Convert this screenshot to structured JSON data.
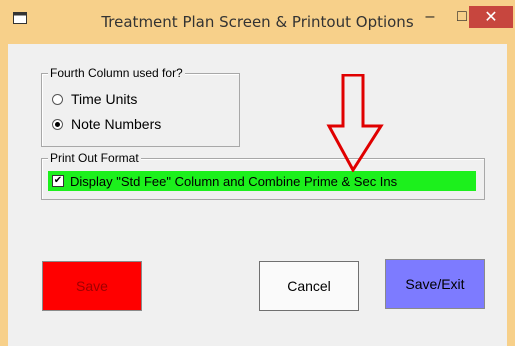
{
  "window": {
    "title": "Treatment Plan Screen & Printout Options",
    "controls": {
      "minimize": "–",
      "maximize": "□",
      "close": "✕"
    }
  },
  "fourth_column": {
    "label": "Fourth Column used for?",
    "options": [
      {
        "label": "Time Units",
        "selected": false
      },
      {
        "label": "Note Numbers",
        "selected": true
      }
    ]
  },
  "print_format": {
    "label": "Print Out Format",
    "checkbox_label": "Display \"Std Fee\" Column and Combine Prime & Sec Ins",
    "checked": true,
    "highlight_color": "#1cf01c"
  },
  "buttons": {
    "save": "Save",
    "cancel": "Cancel",
    "save_exit": "Save/Exit"
  },
  "colors": {
    "title_bar": "#f7d08a",
    "save_bg": "#ff0000",
    "save_exit_bg": "#7d7bff",
    "arrow": "#e00000"
  },
  "icons": {
    "annotation": "down-arrow-icon"
  }
}
